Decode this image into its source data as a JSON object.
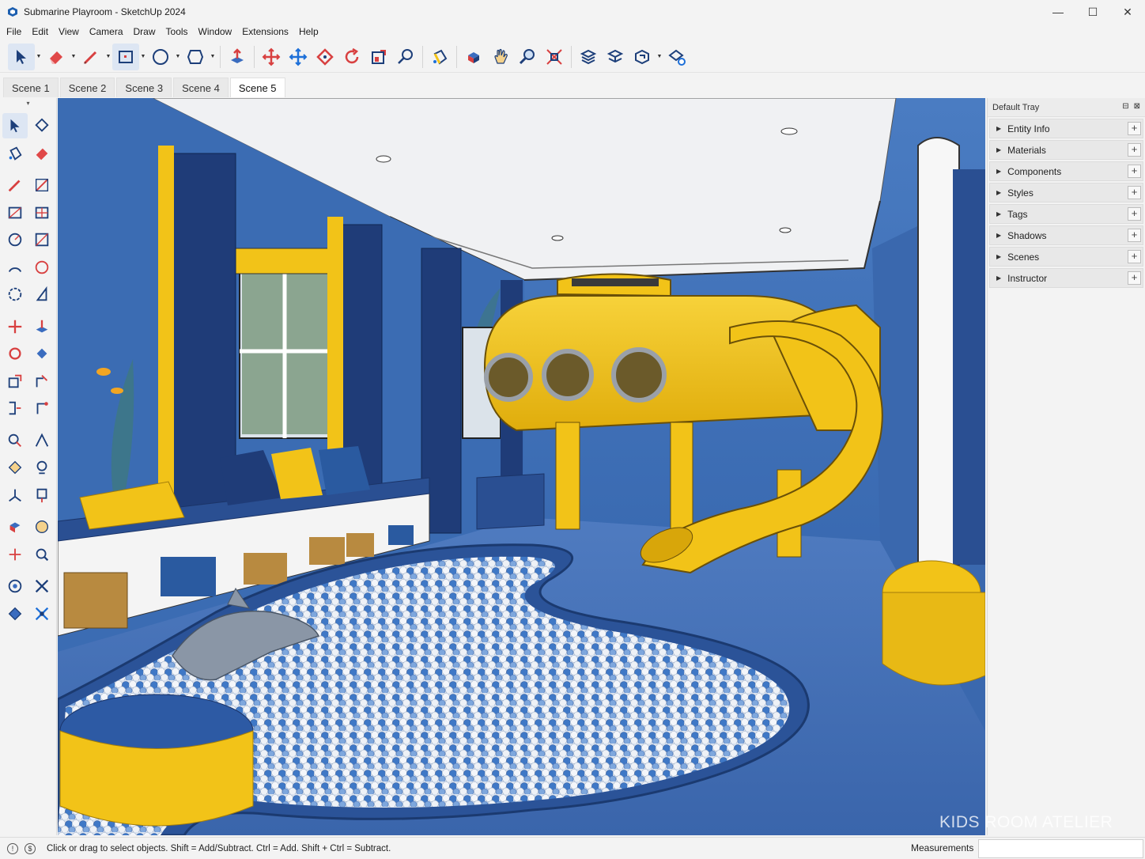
{
  "window": {
    "title": "Submarine Playroom - SketchUp 2024",
    "controls": {
      "minimize": "—",
      "maximize": "☐",
      "close": "✕"
    }
  },
  "menu": [
    "File",
    "Edit",
    "View",
    "Camera",
    "Draw",
    "Tools",
    "Window",
    "Extensions",
    "Help"
  ],
  "toolbar": {
    "tools": [
      "select-tool",
      "eraser-tool",
      "line-tool",
      "rectangle-tool",
      "circle-tool",
      "polygon-tool",
      "push-pull-tool",
      "move-tool",
      "move-alt-tool",
      "scale-tool",
      "rotate-tool",
      "offset-tool",
      "tape-measure-tool",
      "paint-bucket-tool",
      "orbit-tool",
      "pan-tool",
      "zoom-tool",
      "zoom-extents-tool",
      "3d-warehouse-tool",
      "extension-warehouse-tool",
      "layout-tool",
      "send-to-layout-tool"
    ]
  },
  "scenes": [
    "Scene 1",
    "Scene 2",
    "Scene 3",
    "Scene 4",
    "Scene 5"
  ],
  "active_scene": "Scene 5",
  "tray": {
    "title": "Default Tray",
    "panels": [
      "Entity Info",
      "Materials",
      "Components",
      "Styles",
      "Tags",
      "Shadows",
      "Scenes",
      "Instructor"
    ]
  },
  "status": {
    "hint": "Click or drag to select objects. Shift = Add/Subtract. Ctrl = Add. Shift + Ctrl = Subtract.",
    "measurements_label": "Measurements",
    "measurements_value": ""
  },
  "watermark": "KIDS ROOM ATELIER",
  "colors": {
    "wall_blue": "#3d6db0",
    "navy_curtain": "#1f3c78",
    "sub_yellow": "#f2c318",
    "carpet_blue": "#4a72b5",
    "ball_white": "#eef1f6",
    "ball_blue": "#3f78c6",
    "tool_red": "#e04040",
    "tool_blue": "#1d6fd8"
  }
}
